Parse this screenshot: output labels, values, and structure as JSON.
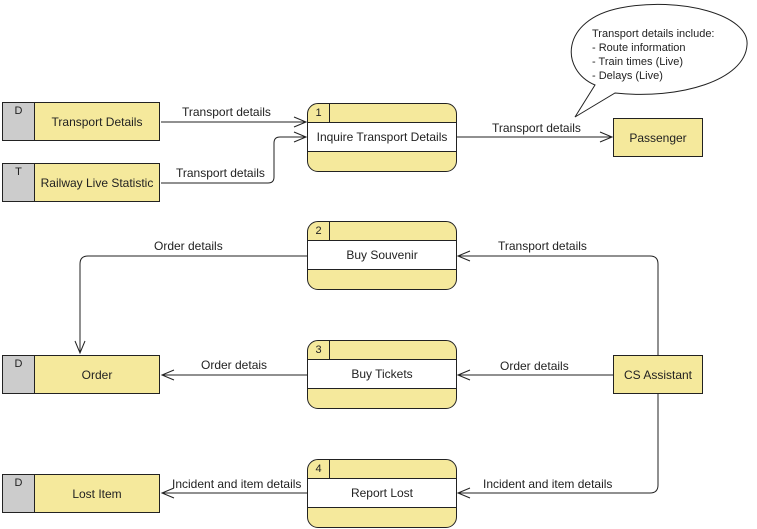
{
  "colors": {
    "fill": "#f5e99c",
    "store_tag": "#cccccc",
    "stroke": "#222222"
  },
  "data_stores": [
    {
      "tag": "D",
      "name": "Transport Details"
    },
    {
      "tag": "T",
      "name": "Railway Live Statistic"
    },
    {
      "tag": "D",
      "name": "Order"
    },
    {
      "tag": "D",
      "name": "Lost Item"
    }
  ],
  "processes": [
    {
      "number": "1",
      "name": "Inquire Transport Details"
    },
    {
      "number": "2",
      "name": "Buy Souvenir"
    },
    {
      "number": "3",
      "name": "Buy Tickets"
    },
    {
      "number": "4",
      "name": "Report Lost"
    }
  ],
  "external_entities": [
    {
      "name": "Passenger"
    },
    {
      "name": "CS Assistant"
    }
  ],
  "flows": [
    {
      "label": "Transport details",
      "from": "Transport Details",
      "to": "Inquire Transport Details"
    },
    {
      "label": "Transport details",
      "from": "Railway Live Statistic",
      "to": "Inquire Transport Details"
    },
    {
      "label": "Transport details",
      "from": "Inquire Transport Details",
      "to": "Passenger"
    },
    {
      "label": "Order details",
      "from": "Buy Souvenir",
      "to": "Order"
    },
    {
      "label": "Transport details",
      "from": "CS Assistant",
      "to": "Buy Souvenir"
    },
    {
      "label": "Order detais",
      "from": "Buy Tickets",
      "to": "Order"
    },
    {
      "label": "Order details",
      "from": "CS Assistant",
      "to": "Buy Tickets"
    },
    {
      "label": "Incident and item details",
      "from": "Report Lost",
      "to": "Lost Item"
    },
    {
      "label": "Incident and item details",
      "from": "CS Assistant",
      "to": "Report Lost"
    }
  ],
  "callout": {
    "title": "Transport details include:",
    "lines": [
      "- Route information",
      "- Train times (Live)",
      "- Delays (Live)"
    ]
  }
}
